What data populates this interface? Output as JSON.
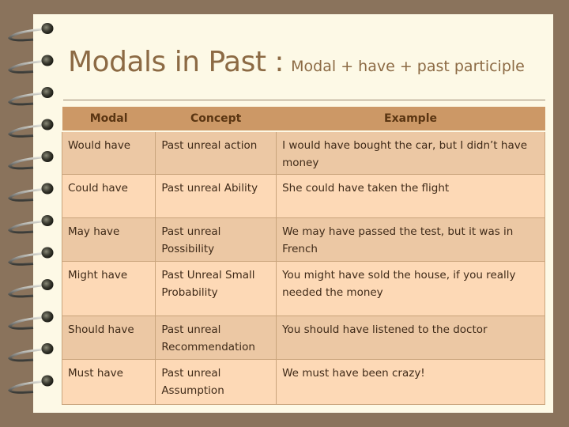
{
  "slide": {
    "title_main": "Modals in Past :",
    "title_sub": "Modal + have + past participle"
  },
  "table": {
    "headers": [
      "Modal",
      "Concept",
      "Example"
    ],
    "rows": [
      {
        "modal": "Would have",
        "concept": "Past unreal action",
        "example": "I would have bought the car, but I didn’t have money"
      },
      {
        "modal": "Could have",
        "concept": "Past unreal Ability",
        "example": "She could have taken the flight"
      },
      {
        "modal": "May have",
        "concept": "Past unreal Possibility",
        "example": "We may have passed the test, but it was in French"
      },
      {
        "modal": "Might have",
        "concept": "Past Unreal Small Probability",
        "example": "You might have sold the house, if you really needed the money"
      },
      {
        "modal": "Should have",
        "concept": "Past unreal Recommendation",
        "example": "You should have listened to the doctor"
      },
      {
        "modal": "Must have",
        "concept": "Past unreal Assumption",
        "example": "We must have been crazy!"
      }
    ]
  },
  "decor": {
    "spiral_rings": 12,
    "spiral_icon": "notebook-spiral-binding"
  }
}
